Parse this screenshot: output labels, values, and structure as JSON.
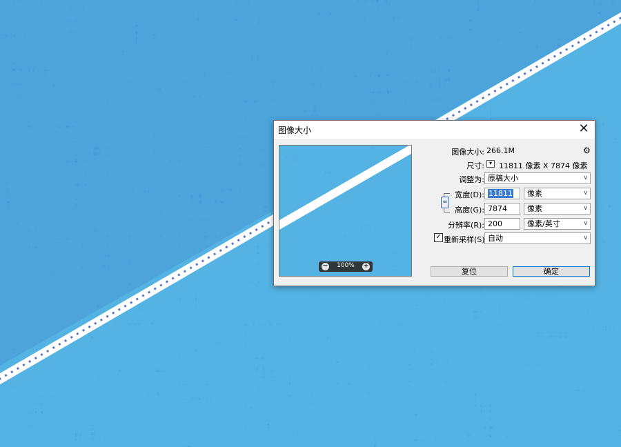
{
  "dialog": {
    "title": "图像大小",
    "close_glyph": "✕",
    "preview": {
      "zoom_out_glyph": "−",
      "zoom_in_glyph": "+",
      "zoom": "100%"
    },
    "image_size": {
      "label": "图像大小:",
      "value": "266.1M"
    },
    "dimensions": {
      "label": "尺寸:",
      "value": "11811 像素  X  7874 像素"
    },
    "fit_to": {
      "label": "调整为:",
      "value": "原稿大小"
    },
    "width": {
      "label": "宽度(D):",
      "value": "11811",
      "unit": "像素"
    },
    "height": {
      "label": "高度(G):",
      "value": "7874",
      "unit": "像素"
    },
    "resolution": {
      "label": "分辨率(R):",
      "value": "200",
      "unit": "像素/英寸"
    },
    "resample": {
      "label": "重新采样(S):",
      "checked": true,
      "value": "自动"
    },
    "buttons": {
      "reset": "复位",
      "ok": "确定"
    }
  },
  "icons": {
    "gear": "gear-icon",
    "link": "link-icon",
    "chevron": "chevron-down-icon",
    "close": "close-icon"
  },
  "colors": {
    "accent": "#3a7bd5",
    "fabric_blue": "#2f8fd0",
    "stripe": "#ffffff"
  }
}
